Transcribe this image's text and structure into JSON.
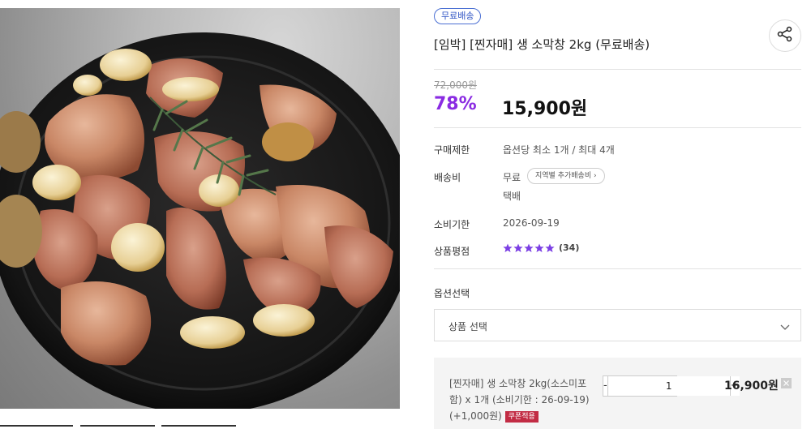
{
  "product": {
    "badge": "무료배송",
    "title": "[임박] [찐자매] 생 소막창 2kg (무료배송)",
    "original_price": "72,000원",
    "discount": "78%",
    "price": "15,900원"
  },
  "details": {
    "purchase_limit_label": "구매제한",
    "purchase_limit_value": "옵션당 최소 1개 / 최대 4개",
    "shipping_label": "배송비",
    "shipping_value": "무료",
    "shipping_extra_chip": "지역별 추가배송비",
    "shipping_method": "택배",
    "expiry_label": "소비기한",
    "expiry_value": "2026-09-19",
    "rating_label": "상품평점",
    "rating_stars": 5,
    "rating_count": "(34)"
  },
  "option": {
    "label": "옵션선택",
    "select_placeholder": "상품 선택",
    "selected_desc": "[찐자매] 생 소막창 2kg(소스미포함) x 1개 (소비기한 : 26-09-19) (+1,000원)",
    "coupon_label": "쿠폰적용",
    "minus": "-",
    "quantity": "1",
    "plus": "+",
    "item_price": "16,900원"
  },
  "colors": {
    "badge": "#2f54c4",
    "discount": "#8a2be2",
    "star": "#7b3fe4",
    "coupon": "#c22c44"
  },
  "icons": {
    "share": "share-icon",
    "chevron": "chevron-down-icon",
    "star": "star-icon",
    "remove": "close-icon"
  }
}
